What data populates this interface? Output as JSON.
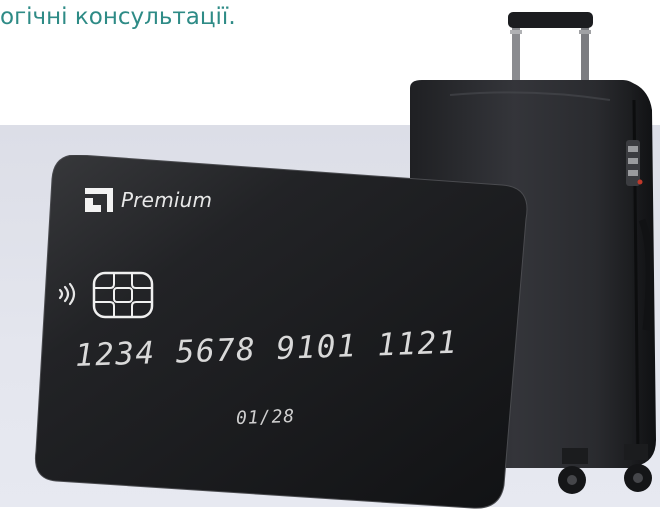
{
  "heading": "огічні консультації.",
  "card": {
    "brand": "Premium",
    "number": "1234 5678 9101 1121",
    "expiry": "01/28"
  },
  "colors": {
    "heading": "#2e8b86",
    "panel_bg": "#dcdee7",
    "card_body": "#1b1c1e",
    "suitcase_body": "#2b2c2f"
  },
  "icons": {
    "brand": "bank-logo-icon",
    "contactless": "contactless-icon",
    "chip": "chip-icon"
  }
}
